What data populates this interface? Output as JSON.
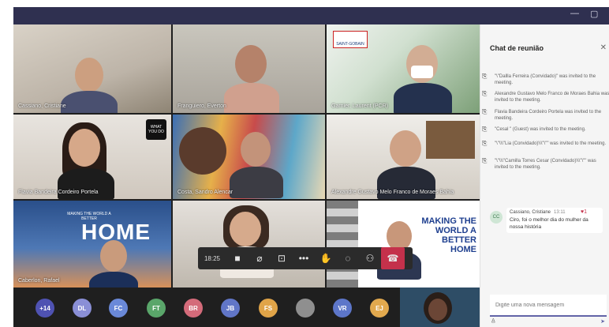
{
  "window": {
    "minimize_icon": "minimize-icon",
    "maximize_icon": "maximize-icon"
  },
  "participants": [
    {
      "name": "Cassiano, Cristiane"
    },
    {
      "name": "Franguiero, Everton"
    },
    {
      "name": "Garnier, Laurent (PCR)"
    },
    {
      "name": "Flavia Bandeira Cordeiro Portela"
    },
    {
      "name": "Costa, Sandro Alencar"
    },
    {
      "name": "Alexandre Gustavo Melo Franco de Moraes Bahia"
    },
    {
      "name": "Caberlon, Rafael"
    },
    {
      "name": ""
    },
    {
      "name": ""
    }
  ],
  "tile_text": {
    "what_you_do": "WHAT YOU DO",
    "home_small": "MAKING THE WORLD A BETTER",
    "home_big": "HOME",
    "saint_gobain": "SAINT-GOBAIN",
    "making_world": "MAKING THE WORLD A BETTER HOME"
  },
  "callbar": {
    "time": "18:25",
    "icons": [
      "camera-icon",
      "microphone-icon",
      "share-screen-icon",
      "more-icon",
      "raise-hand-icon",
      "chat-icon",
      "participants-icon",
      "hang-up-icon"
    ]
  },
  "roster": [
    {
      "initials": "+14",
      "color": "#4f52b2"
    },
    {
      "initials": "DL",
      "color": "#8a8fd6"
    },
    {
      "initials": "FC",
      "color": "#6a89d8"
    },
    {
      "initials": "FT",
      "color": "#5aa66a"
    },
    {
      "initials": "BR",
      "color": "#d46b7a"
    },
    {
      "initials": "JB",
      "color": "#6176c7"
    },
    {
      "initials": "FS",
      "color": "#e0a448"
    },
    {
      "initials": "",
      "color": "#8f8f8f"
    },
    {
      "initials": "VR",
      "color": "#5d76c9"
    },
    {
      "initials": "EJ",
      "color": "#e2a94e"
    }
  ],
  "chat": {
    "title": "Chat de reunião",
    "system_messages": [
      "\"\\\"Dallla Ferreira (Convidado)\" was invited to the meeting.",
      "Alexandre Gustavo Melo Franco de Moraes Bahia was invited to the meeting.",
      "Flavia Bandeira Cordeiro Portela was invited to the meeting.",
      "\"Cesal \" (Guest) was invited to the meeting.",
      "\"\\\"\\\\\\\"Lia (Convidado)\\\\\\\"\\\"\" was invited to the meeting.",
      "\"\\\"\\\\\\\"Camilla Torres Cesar (Convidado)\\\\\\\"\\\"\" was invited to the meeting."
    ],
    "message": {
      "initials": "CC",
      "author": "Cassiano, Cristiane",
      "time": "13:11",
      "reaction": "1",
      "text": "Ciro, foi o melhor dia do mulher da nossa história"
    },
    "compose_placeholder": "Digite uma nova mensagem"
  }
}
